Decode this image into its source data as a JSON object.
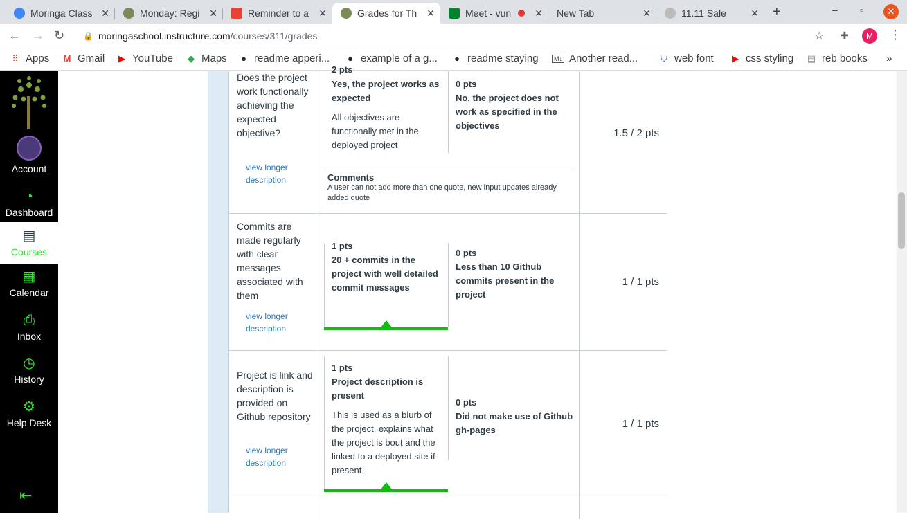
{
  "browser": {
    "tabs": [
      {
        "title": "Moringa Class",
        "favicon_color": "#4285f4"
      },
      {
        "title": "Monday: Regi",
        "favicon_color": "#7a8b5a"
      },
      {
        "title": "Reminder to a",
        "favicon_color": "#ea4335"
      },
      {
        "title": "Grades for Th",
        "favicon_color": "#7a8b5a"
      },
      {
        "title": "Meet - vun",
        "favicon_color": "#00832d"
      },
      {
        "title": "New Tab",
        "favicon_color": ""
      },
      {
        "title": "11.11 Sale",
        "favicon_color": "#555"
      }
    ],
    "active_tab": 3,
    "url_host": "moringaschool.instructure.com",
    "url_path": "/courses/311/grades",
    "profile_initial": "M",
    "bookmarks": [
      {
        "label": "Apps",
        "icon": "apps-grid-icon"
      },
      {
        "label": "Gmail",
        "icon": "gmail-icon"
      },
      {
        "label": "YouTube",
        "icon": "youtube-icon"
      },
      {
        "label": "Maps",
        "icon": "maps-icon"
      },
      {
        "label": "readme apperi...",
        "icon": "github-icon"
      },
      {
        "label": "example of a g...",
        "icon": "github-icon"
      },
      {
        "label": "readme staying",
        "icon": "github-icon"
      },
      {
        "label": "Another read...",
        "icon": "markdown-icon"
      },
      {
        "label": "web font",
        "icon": "shield-icon"
      },
      {
        "label": "css styling",
        "icon": "youtube-icon"
      },
      {
        "label": "reb books",
        "icon": "book-icon"
      }
    ],
    "more_label": "»"
  },
  "sidebar": {
    "items": [
      {
        "label": "Account",
        "icon": "avatar"
      },
      {
        "label": "Dashboard",
        "icon": "dashboard-icon"
      },
      {
        "label": "Courses",
        "icon": "courses-icon"
      },
      {
        "label": "Calendar",
        "icon": "calendar-icon"
      },
      {
        "label": "Inbox",
        "icon": "inbox-icon"
      },
      {
        "label": "History",
        "icon": "history-icon"
      },
      {
        "label": "Help Desk",
        "icon": "help-icon"
      }
    ],
    "active": "Courses",
    "colors": {
      "accent": "#2ee62e",
      "bg": "#000000"
    }
  },
  "rubric": {
    "rows": [
      {
        "criterion": "Does the project work functionally achieving the expected objective?",
        "view_longer": "view longer description",
        "top_cut": "2 pts",
        "rating_a_title": "Yes, the project works as expected",
        "rating_a_desc": "All objectives are functionally met in the deployed project",
        "rating_b_pts": "0 pts",
        "rating_b_title": "No, the project does not work as specified in the objectives",
        "score": "1.5 / 2 pts",
        "comments_label": "Comments",
        "comment": "A user can not add more than one quote, new input updates already added quote"
      },
      {
        "criterion": "Commits are made regularly with clear messages associated with them",
        "view_longer": "view longer description",
        "rating_a_pts": "1 pts",
        "rating_a_title": "20 + commits in the project with well detailed commit messages",
        "rating_b_pts": "0 pts",
        "rating_b_title": "Less than 10 Github commits present in the project",
        "score": "1 / 1 pts"
      },
      {
        "criterion": "Project is link and description is provided on Github repository",
        "view_longer": "view longer description",
        "rating_a_pts": "1 pts",
        "rating_a_title": "Project description is present",
        "rating_a_desc": "This is used as a blurb of the project, explains what the project is bout and the linked to a deployed site if present",
        "rating_b_pts": "0 pts",
        "rating_b_title": "Did not make use of Github gh-pages",
        "score": "1 / 1 pts"
      }
    ],
    "selected_color": "#0fbc0f"
  }
}
